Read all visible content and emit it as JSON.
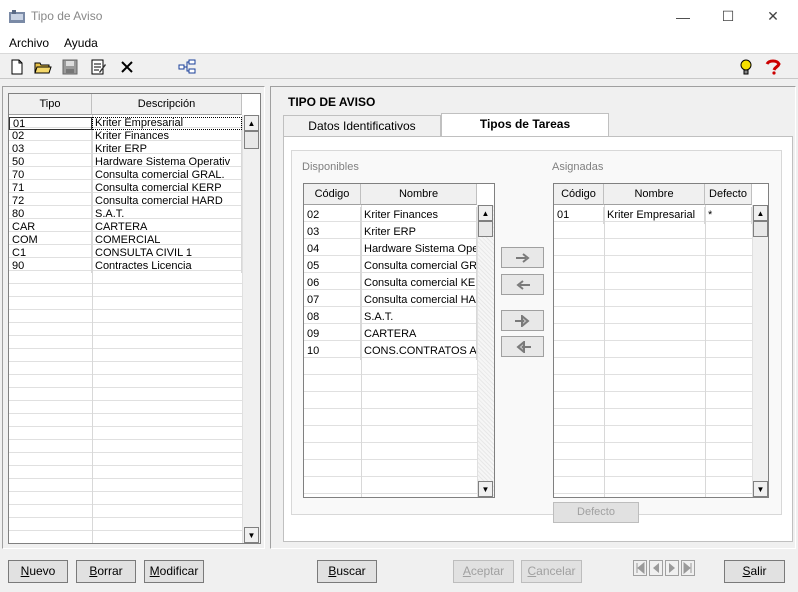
{
  "window": {
    "title": "Tipo de Aviso",
    "minimize": "—",
    "maximize": "☐",
    "close": "✕"
  },
  "menu": [
    {
      "label": "Archivo"
    },
    {
      "label": "Ayuda"
    }
  ],
  "left_grid": {
    "headers": [
      "Tipo",
      "Descripción"
    ],
    "rows": [
      {
        "tipo": "01",
        "desc": "Kriter Empresarial"
      },
      {
        "tipo": "02",
        "desc": "Kriter Finances"
      },
      {
        "tipo": "03",
        "desc": "Kriter ERP"
      },
      {
        "tipo": "50",
        "desc": "Hardware Sistema Operativ"
      },
      {
        "tipo": "70",
        "desc": "Consulta comercial GRAL."
      },
      {
        "tipo": "71",
        "desc": "Consulta comercial KERP"
      },
      {
        "tipo": "72",
        "desc": "Consulta comercial HARD"
      },
      {
        "tipo": "80",
        "desc": "S.A.T."
      },
      {
        "tipo": "CAR",
        "desc": "CARTERA"
      },
      {
        "tipo": "COM",
        "desc": "COMERCIAL"
      },
      {
        "tipo": "C1",
        "desc": "CONSULTA CIVIL 1"
      },
      {
        "tipo": "90",
        "desc": "Contractes Licencia"
      }
    ]
  },
  "panel": {
    "heading": "TIPO DE AVISO",
    "tabs": [
      {
        "label": "Datos Identificativos"
      },
      {
        "label": "Tipos de Tareas"
      }
    ],
    "disponibles_label": "Disponibles",
    "asignadas_label": "Asignadas",
    "disponibles": {
      "headers": [
        "Código",
        "Nombre"
      ],
      "rows": [
        {
          "codigo": "02",
          "nombre": "Kriter Finances"
        },
        {
          "codigo": "03",
          "nombre": "Kriter ERP"
        },
        {
          "codigo": "04",
          "nombre": "Hardware Sistema Oper"
        },
        {
          "codigo": "05",
          "nombre": "Consulta comercial GRA"
        },
        {
          "codigo": "06",
          "nombre": "Consulta comercial KER"
        },
        {
          "codigo": "07",
          "nombre": "Consulta comercial HAF"
        },
        {
          "codigo": "08",
          "nombre": "S.A.T."
        },
        {
          "codigo": "09",
          "nombre": "CARTERA"
        },
        {
          "codigo": "10",
          "nombre": "CONS.CONTRATOS AL"
        }
      ]
    },
    "asignadas": {
      "headers": [
        "Código",
        "Nombre",
        "Defecto"
      ],
      "rows": [
        {
          "codigo": "01",
          "nombre": "Kriter Empresarial",
          "defecto": "*"
        }
      ]
    },
    "defecto_button": "Defecto"
  },
  "buttons": {
    "nuevo": {
      "u": "N",
      "rest": "uevo"
    },
    "borrar": {
      "u": "B",
      "rest": "orrar"
    },
    "modificar": {
      "u": "M",
      "rest": "odificar"
    },
    "buscar": {
      "u": "B",
      "rest": "uscar"
    },
    "aceptar": {
      "u": "A",
      "rest": "ceptar"
    },
    "cancelar": {
      "u": "C",
      "rest": "ancelar"
    },
    "salir": {
      "u": "S",
      "rest": "alir"
    }
  },
  "colors": {
    "accent_arrow": "#7a7a7a",
    "selected_tab_bg": "#ffffff",
    "help_icon_red": "#cc0000",
    "bulb_yellow": "#f5e000"
  }
}
